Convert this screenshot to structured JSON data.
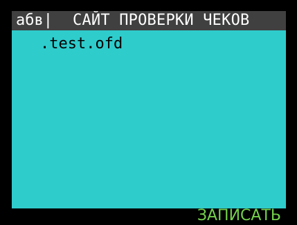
{
  "header": {
    "input_mode": "абв|",
    "title": "САЙТ ПРОВЕРКИ ЧЕКОВ"
  },
  "field": {
    "value": ".test.ofd"
  },
  "softkey": {
    "right_label": "ЗАПИСАТЬ"
  },
  "colors": {
    "screen_bg": "#2fcccc",
    "header_bg": "#404040",
    "softkey_text": "#74d14c"
  }
}
